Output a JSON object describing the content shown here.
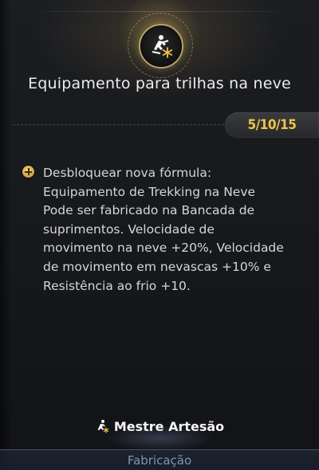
{
  "skill": {
    "icon": "skier-snowflake-icon",
    "title": "Equipamento para trilhas na neve",
    "level": "5/10/15"
  },
  "effect": {
    "icon": "plus-circle-icon",
    "lines": [
      "Desbloquear nova fórmula:",
      "Equipamento de Trekking na Neve",
      "Pode ser fabricado na Bancada de",
      "suprimentos. Velocidade de",
      "movimento na neve +20%, Velocidade",
      "de movimento em nevascas +10% e",
      "Resistência ao frio +10."
    ]
  },
  "footer": {
    "rank_icon": "runner-icon",
    "rank_label": "Mestre Artesão",
    "tab_label": "Fabricação"
  },
  "colors": {
    "level": "#f0c44a",
    "accent_gold": "#b7a06a",
    "tab_text": "#7f93b8"
  }
}
